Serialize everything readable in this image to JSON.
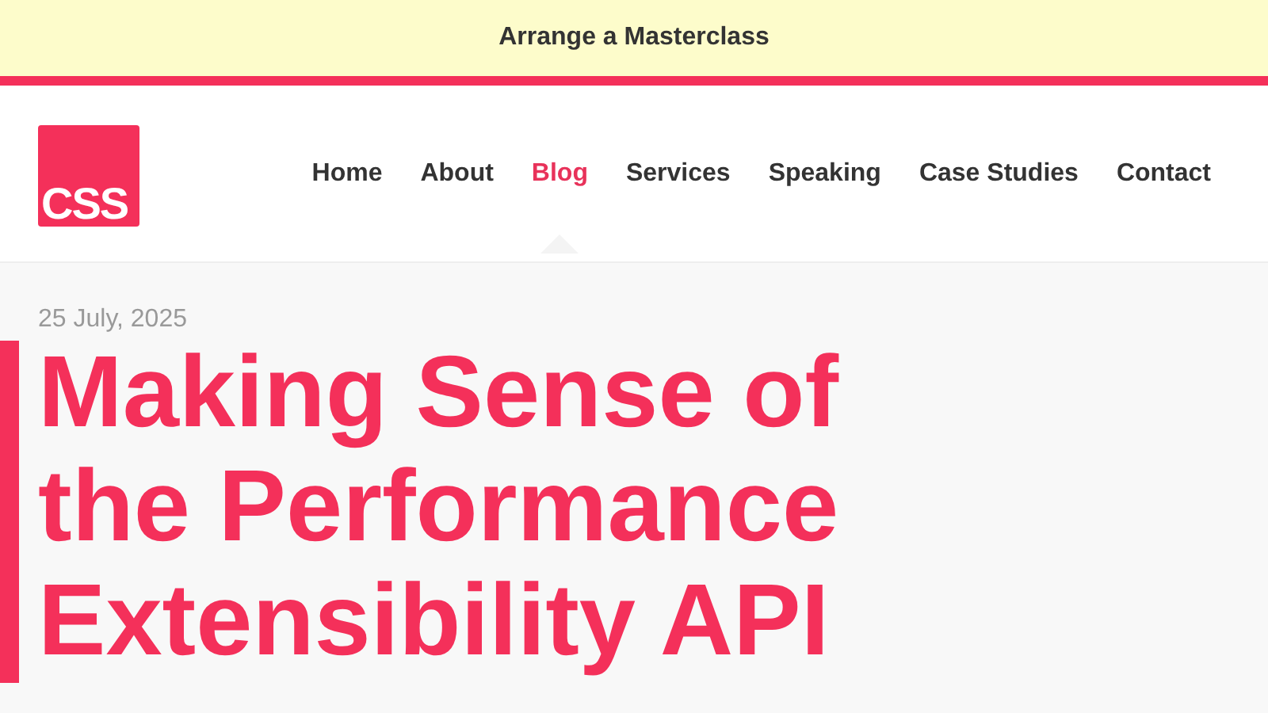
{
  "banner": {
    "text": "Arrange a Masterclass"
  },
  "logo": {
    "text": "CSS"
  },
  "nav": [
    {
      "label": "Home",
      "selected": false
    },
    {
      "label": "About",
      "selected": false
    },
    {
      "label": "Blog",
      "selected": true
    },
    {
      "label": "Services",
      "selected": false
    },
    {
      "label": "Speaking",
      "selected": false
    },
    {
      "label": "Case Studies",
      "selected": false
    },
    {
      "label": "Contact",
      "selected": false
    }
  ],
  "article": {
    "date": "25 July, 2025",
    "title": "Making Sense of the Performance Extensibility API"
  }
}
